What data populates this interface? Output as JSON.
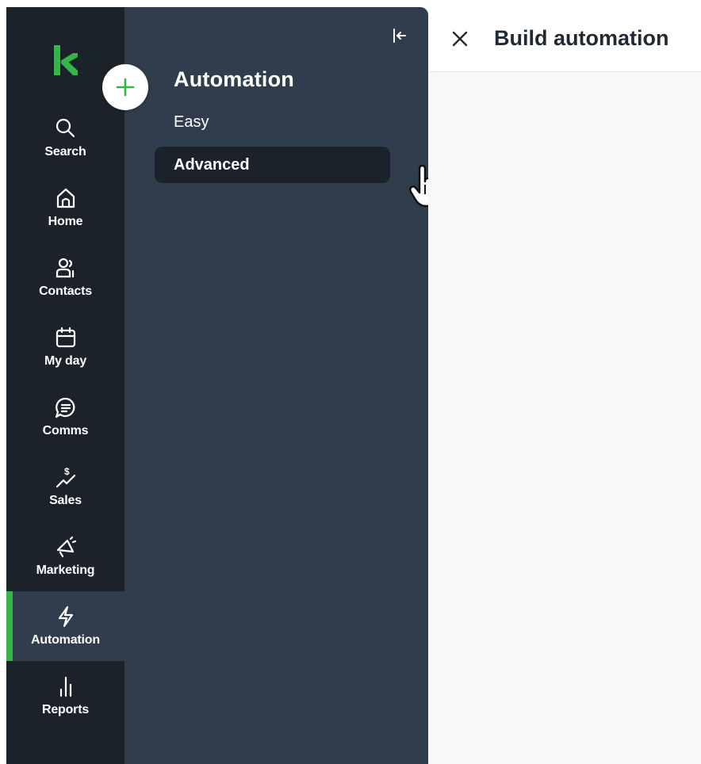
{
  "rail": {
    "items": [
      {
        "label": "Search",
        "icon": "search-icon"
      },
      {
        "label": "Home",
        "icon": "home-icon"
      },
      {
        "label": "Contacts",
        "icon": "contacts-icon"
      },
      {
        "label": "My day",
        "icon": "calendar-icon"
      },
      {
        "label": "Comms",
        "icon": "chat-icon"
      },
      {
        "label": "Sales",
        "icon": "sales-icon"
      },
      {
        "label": "Marketing",
        "icon": "megaphone-icon"
      },
      {
        "label": "Automation",
        "icon": "lightning-icon",
        "active": true
      },
      {
        "label": "Reports",
        "icon": "bar-chart-icon"
      }
    ]
  },
  "panel": {
    "title": "Automation",
    "items": [
      {
        "label": "Easy"
      },
      {
        "label": "Advanced",
        "selected": true
      }
    ]
  },
  "header": {
    "title": "Build automation"
  },
  "colors": {
    "rail_bg": "#1b2229",
    "panel_bg": "#2f3d4c",
    "accent_green": "#35b44a",
    "selected_item_bg": "#1b2229",
    "main_bg": "#f8f8f8"
  }
}
